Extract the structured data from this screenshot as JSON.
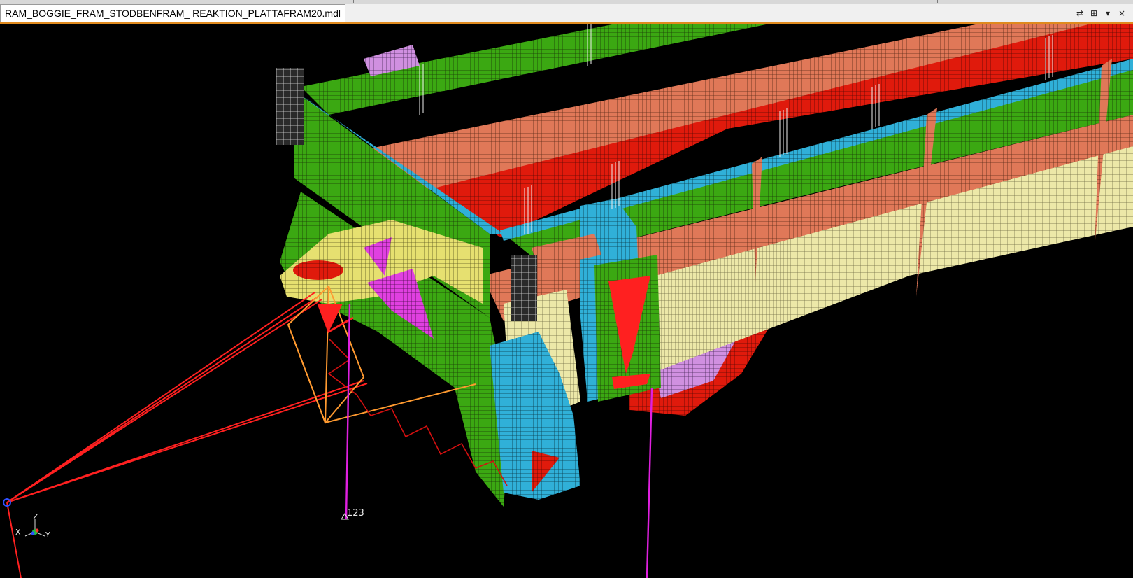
{
  "window": {
    "tab_title": "RAM_BOGGIE_FRAM_STODBENFRAM_ REAKTION_PLATTAFRAM20.mdl",
    "tab_controls": [
      "⇄",
      "⊞",
      "▾",
      "×"
    ]
  },
  "viewport": {
    "node_label": "123",
    "triad": {
      "z": "Z",
      "x": "X",
      "y": "Y"
    }
  },
  "colors": {
    "background": "#000000",
    "active_border": "#e08a1e",
    "mesh_green": "#3ba812",
    "mesh_red": "#e01a0c",
    "mesh_salmon": "#e07858",
    "mesh_yellow": "#e6e070",
    "mesh_cream": "#ece8a8",
    "mesh_cyan": "#30b0d8",
    "mesh_magenta": "#e040e0",
    "mesh_lilac": "#d090e0",
    "rbe_red": "#ff2020",
    "rbe_orange": "#ff9a30",
    "spring_red": "#d41010",
    "beam_magenta": "#e020e0"
  }
}
